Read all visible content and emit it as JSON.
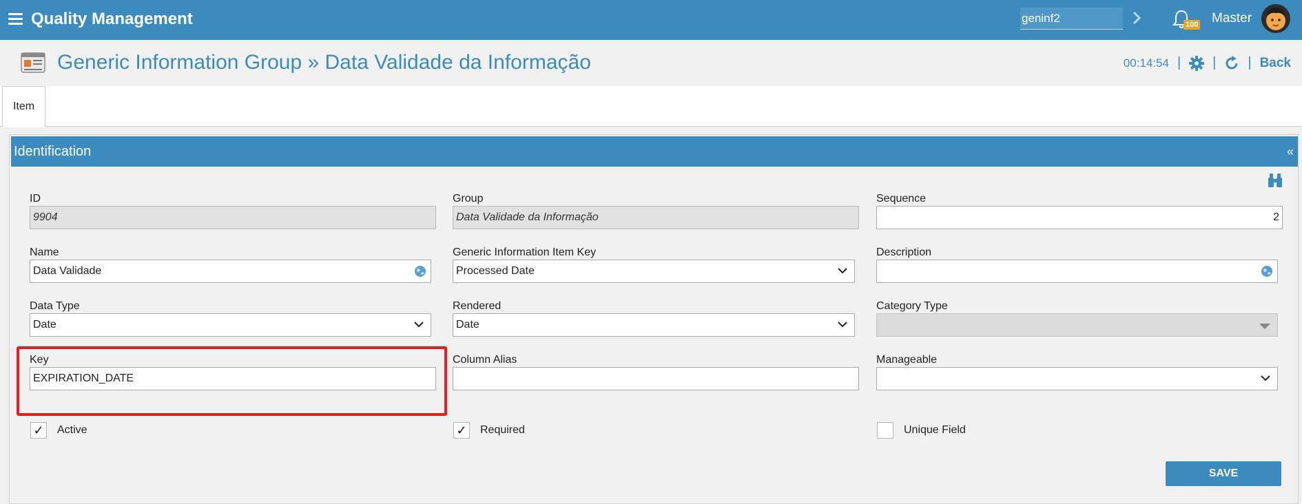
{
  "app": {
    "title": "Quality Management",
    "search_value": "geninf2",
    "notification_count": "100",
    "user_name": "Master"
  },
  "header": {
    "title": "Generic Information Group » Data Validade da Informação",
    "timer": "00:14:54",
    "separator": "|",
    "back_label": "Back"
  },
  "tabs": [
    {
      "label": "Item",
      "active": true
    }
  ],
  "panel": {
    "title": "Identification",
    "collapse_glyph": "«"
  },
  "fields": {
    "id": {
      "label": "ID",
      "value": "9904"
    },
    "group": {
      "label": "Group",
      "value": "Data Validade da Informação"
    },
    "sequence": {
      "label": "Sequence",
      "value": "2"
    },
    "name": {
      "label": "Name",
      "value": "Data Validade"
    },
    "item_key": {
      "label": "Generic Information Item Key",
      "value": "Processed Date"
    },
    "description": {
      "label": "Description",
      "value": ""
    },
    "data_type": {
      "label": "Data Type",
      "value": "Date"
    },
    "rendered": {
      "label": "Rendered",
      "value": "Date"
    },
    "category_type": {
      "label": "Category Type",
      "value": ""
    },
    "key": {
      "label": "Key",
      "value": "EXPIRATION_DATE"
    },
    "column_alias": {
      "label": "Column Alias",
      "value": ""
    },
    "manageable": {
      "label": "Manageable",
      "value": ""
    }
  },
  "checkboxes": {
    "active": {
      "label": "Active",
      "checked": true,
      "mark": "✓"
    },
    "required": {
      "label": "Required",
      "checked": true,
      "mark": "✓"
    },
    "unique": {
      "label": "Unique Field",
      "checked": false,
      "mark": ""
    }
  },
  "actions": {
    "save_label": "SAVE"
  },
  "colors": {
    "primary": "#3b8bbe",
    "highlight": "#e81e1e",
    "badge": "#f2a21d"
  },
  "icons": [
    "menu-icon",
    "chevron-right-icon",
    "bell-icon",
    "avatar",
    "form-icon",
    "gear-icon",
    "refresh-icon",
    "binoculars-icon",
    "globe-icon",
    "chevron-down-icon"
  ]
}
